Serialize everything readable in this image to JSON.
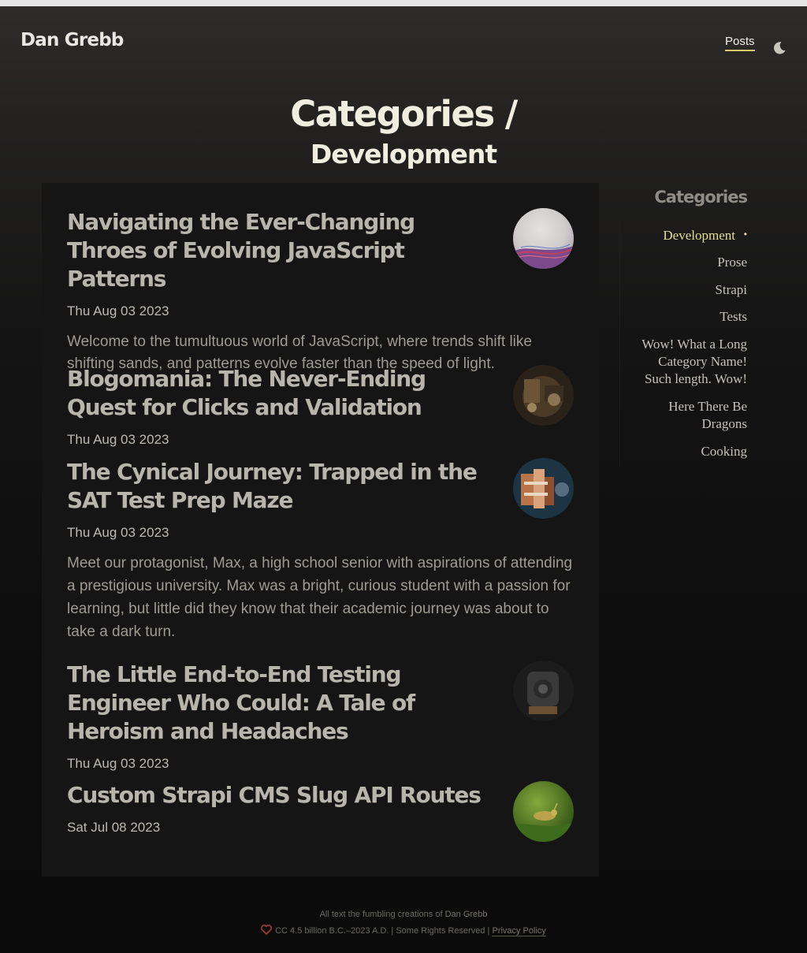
{
  "site": {
    "title": "Dan Grebb"
  },
  "nav": {
    "posts_label": "Posts",
    "theme_icon": "moon-icon"
  },
  "heading": {
    "main": "Categories /",
    "sub": "Development"
  },
  "posts": [
    {
      "title": "Navigating the Ever-Changing Throes of Evolving JavaScript Patterns",
      "date": "Thu Aug 03 2023",
      "excerpt": "Welcome to the tumultuous world of JavaScript, where trends shift like shifting sands, and patterns evolve faster than the speed of light."
    },
    {
      "title": "Blogomania: The Never-Ending Quest for Clicks and Validation",
      "date": "Thu Aug 03 2023",
      "excerpt": ""
    },
    {
      "title": "The Cynical Journey: Trapped in the SAT Test Prep Maze",
      "date": "Thu Aug 03 2023",
      "excerpt": "Meet our protagonist, Max, a high school senior with aspirations of attending a prestigious university. Max was a bright, curious student with a passion for learning, but little did they know that their academic journey was about to take a dark turn."
    },
    {
      "title": "The Little End-to-End Testing Engineer Who Could: A Tale of Heroism and Headaches",
      "date": "Thu Aug 03 2023",
      "excerpt": ""
    },
    {
      "title": "Custom Strapi CMS Slug API Routes",
      "date": "Sat Jul 08 2023",
      "excerpt": ""
    }
  ],
  "sidebar": {
    "title": "Categories",
    "active_marker": "•",
    "items": [
      {
        "label": "Development",
        "active": true
      },
      {
        "label": "Prose"
      },
      {
        "label": "Strapi"
      },
      {
        "label": "Tests"
      },
      {
        "label": "Wow! What a Long Category Name! Such length. Wow!"
      },
      {
        "label": "Here There Be Dragons"
      },
      {
        "label": "Cooking"
      }
    ]
  },
  "footer": {
    "line1_prefix": "All text the fumbling creations of",
    "author": "Dan Grebb",
    "license": "CC 4.5 billion B.C.–2023 A.D. | Some Rights Reserved |",
    "privacy": "Privacy Policy",
    "heart_icon": "heart-icon"
  },
  "colors": {
    "accent": "#d9c96a",
    "active_category": "#e6dc9a",
    "panel": "#151515"
  }
}
